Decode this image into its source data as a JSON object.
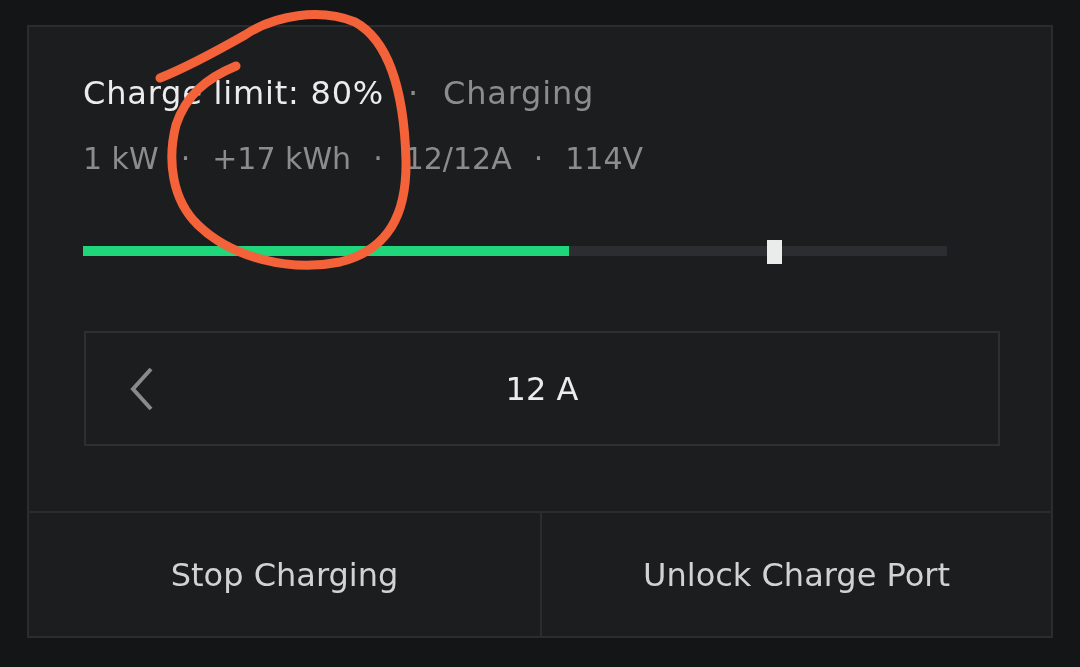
{
  "header": {
    "limit": "Charge limit: 80%",
    "separator": "·",
    "status": "Charging"
  },
  "stats": [
    {
      "text": "1 kW",
      "separator": "·"
    },
    {
      "text": "+17 kWh",
      "separator": "·"
    },
    {
      "text": "12/12A",
      "separator": "·"
    },
    {
      "text": "114V"
    }
  ],
  "charge_bar": {
    "level": 0.5625
  },
  "charge_limit_slider": {
    "level": 0.8
  },
  "current_selector": {
    "value": "12 A",
    "decrease_enabled": true,
    "increase_enabled": false
  },
  "buttons": [
    "Stop Charging",
    "Unlock Charge Port"
  ],
  "annotation": {
    "kind": "freehand-circle"
  }
}
